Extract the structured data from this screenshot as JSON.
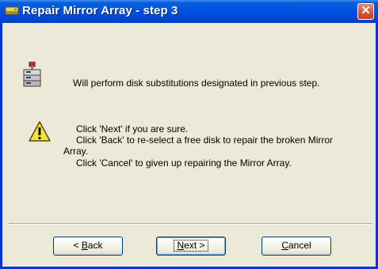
{
  "window": {
    "title": "Repair Mirror Array - step 3",
    "close_glyph": "✕"
  },
  "content": {
    "info_text": "Will perform disk substitutions designated in previous step.",
    "warning_lines": [
      "Click 'Next' if you are sure.",
      "Click 'Back' to re-select a free disk to repair the broken Mirror",
      "Array.",
      "Click 'Cancel' to given up repairing the Mirror Array."
    ]
  },
  "buttons": {
    "back": {
      "prefix": "< ",
      "accel": "B",
      "rest": "ack"
    },
    "next": {
      "accel": "N",
      "rest": "ext >"
    },
    "cancel": {
      "accel": "C",
      "rest": "ancel"
    }
  },
  "icons": [
    "title-drive-icon",
    "disk-array-icon",
    "warning-icon",
    "close-icon"
  ]
}
